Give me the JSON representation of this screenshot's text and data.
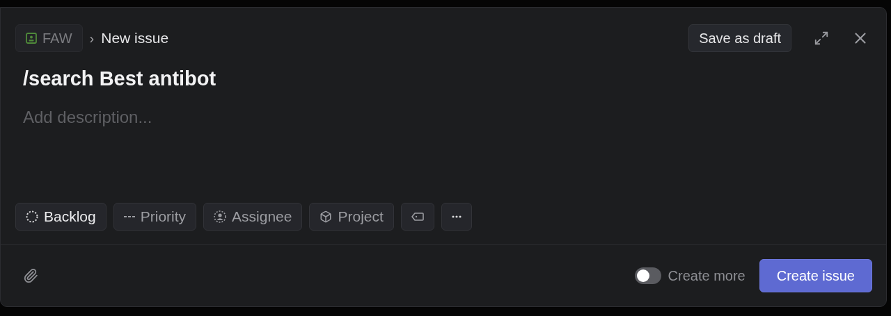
{
  "breadcrumb": {
    "team": "FAW",
    "separator": "›",
    "page": "New issue"
  },
  "header_actions": {
    "save_draft": "Save as draft"
  },
  "issue": {
    "title": "/search Best antibot",
    "description_placeholder": "Add description..."
  },
  "properties": [
    {
      "kind": "status",
      "label": "Backlog"
    },
    {
      "kind": "priority",
      "label": "Priority"
    },
    {
      "kind": "assignee",
      "label": "Assignee"
    },
    {
      "kind": "project",
      "label": "Project"
    },
    {
      "kind": "labels"
    },
    {
      "kind": "more"
    }
  ],
  "footer": {
    "create_more": {
      "label": "Create more",
      "on": false
    },
    "submit": "Create issue"
  }
}
